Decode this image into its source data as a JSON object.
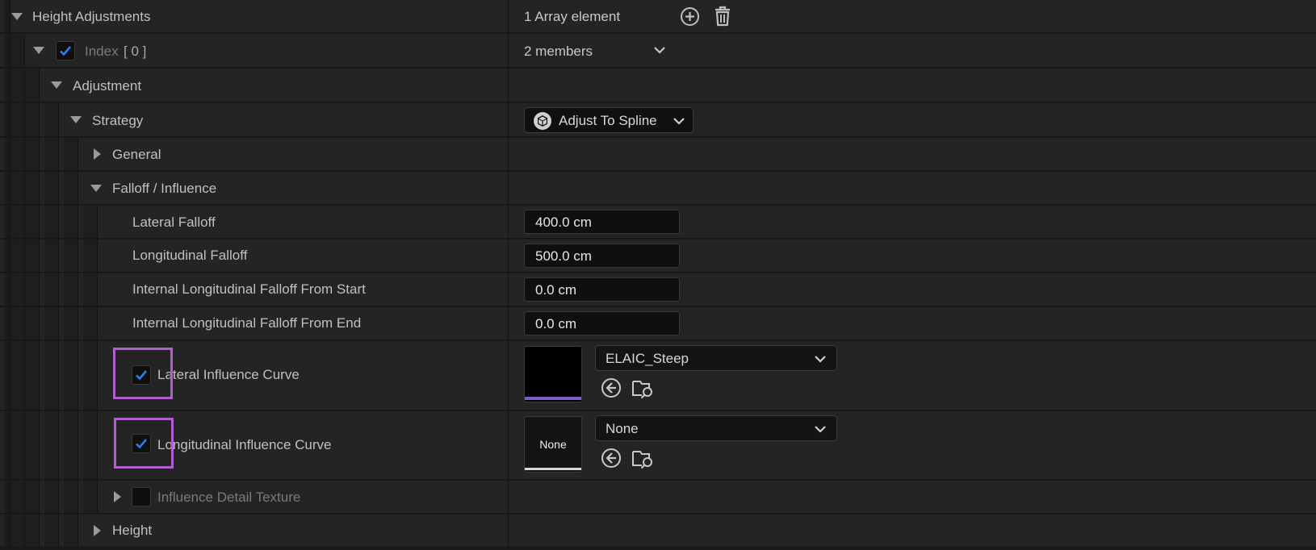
{
  "rows": {
    "height_adjustments": {
      "label": "Height Adjustments",
      "value": "1 Array element"
    },
    "index": {
      "label": "Index",
      "index_value": "[ 0 ]",
      "value": "2 members"
    },
    "adjustment": {
      "label": "Adjustment"
    },
    "strategy": {
      "label": "Strategy",
      "value": "Adjust To Spline"
    },
    "general": {
      "label": "General"
    },
    "falloff": {
      "label": "Falloff / Influence"
    },
    "lateral_falloff": {
      "label": "Lateral Falloff",
      "value": "400.0 cm"
    },
    "longitudinal_falloff": {
      "label": "Longitudinal Falloff",
      "value": "500.0 cm"
    },
    "internal_start": {
      "label": "Internal Longitudinal Falloff From Start",
      "value": "0.0 cm"
    },
    "internal_end": {
      "label": "Internal Longitudinal Falloff From End",
      "value": "0.0 cm"
    },
    "lateral_curve": {
      "label": "Lateral Influence Curve",
      "asset": "ELAIC_Steep",
      "checked": true
    },
    "longitudinal_curve": {
      "label": "Longitudinal Influence Curve",
      "asset": "None",
      "thumb_text": "None",
      "checked": true
    },
    "detail_texture": {
      "label": "Influence Detail Texture",
      "checked": false
    },
    "height": {
      "label": "Height"
    }
  },
  "icons": {
    "add": "plus-circle-icon",
    "delete": "trash-icon",
    "dropdown": "chevron-down-icon",
    "class": "cube-icon",
    "use": "arrow-left-circle-icon",
    "browse": "folder-search-icon"
  },
  "colors": {
    "highlight": "#b25ed0",
    "check": "#2f7fe8"
  }
}
